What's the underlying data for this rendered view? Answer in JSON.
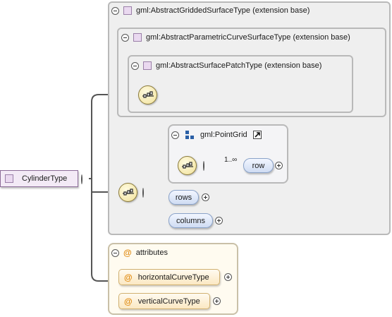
{
  "root": {
    "label": "CylinderType"
  },
  "extensions": [
    {
      "label": "gml:AbstractGriddedSurfaceType (extension base)"
    },
    {
      "label": "gml:AbstractParametricCurveSurfaceType (extension base)"
    },
    {
      "label": "gml:AbstractSurfacePatchType (extension base)"
    }
  ],
  "point_grid": {
    "label": "gml:PointGrid",
    "cardinality": "1..∞",
    "child": "row"
  },
  "elements": {
    "rows": "rows",
    "columns": "columns"
  },
  "attributes": {
    "header": "attributes",
    "items": [
      "horizontalCurveType",
      "verticalCurveType"
    ]
  },
  "icons": {
    "complex_type": "complex-type-icon",
    "sequence": "sequence-compositor-icon",
    "element": "element-icon",
    "reference": "reference-arrow-icon",
    "attribute": "attribute-at-icon"
  },
  "colors": {
    "sequence_fill": "#f1e19a",
    "element_fill": "#cfdcf3",
    "attribute_fill": "#fbe8c2",
    "type_fill": "#ead9f0"
  }
}
